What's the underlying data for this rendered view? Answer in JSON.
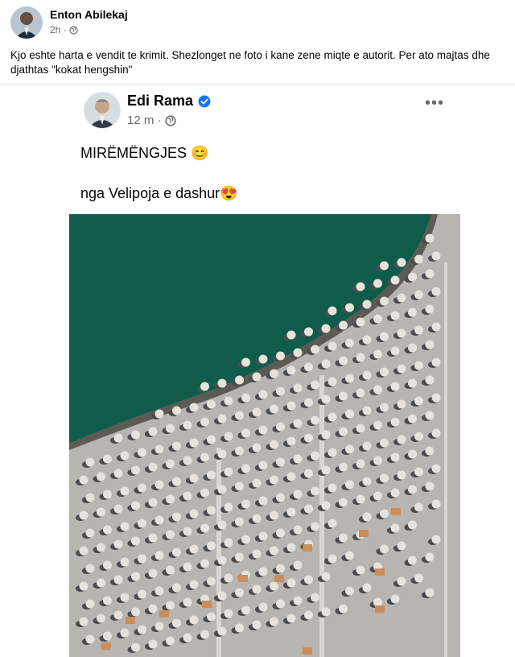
{
  "outer_post": {
    "author": "Enton Abilekaj",
    "time": "2h ·",
    "privacy_icon": "globe-icon",
    "text": "Kjo eshte harta e vendit te krimit. Shezlonget ne foto i kane zene miqte e autorit. Per ato majtas dhe djathtas \"kokat hengshin\""
  },
  "shared_post": {
    "author": "Edi Rama",
    "verified_icon": "verified-badge-icon",
    "time": "12 m ·",
    "privacy_icon": "globe-icon",
    "line1": "MIRËMËNGJES 😊",
    "line2": "nga Velipoja e dashur😍",
    "more_icon": "more-options-icon",
    "more_label": "•••"
  },
  "colors": {
    "sea": "#0f5c4a",
    "sand": "#b9b7b2",
    "umbrella": "#e6e3dc",
    "shadow": "#4a4c4e",
    "link_blue": "#1877f2",
    "muted": "#65676b"
  }
}
